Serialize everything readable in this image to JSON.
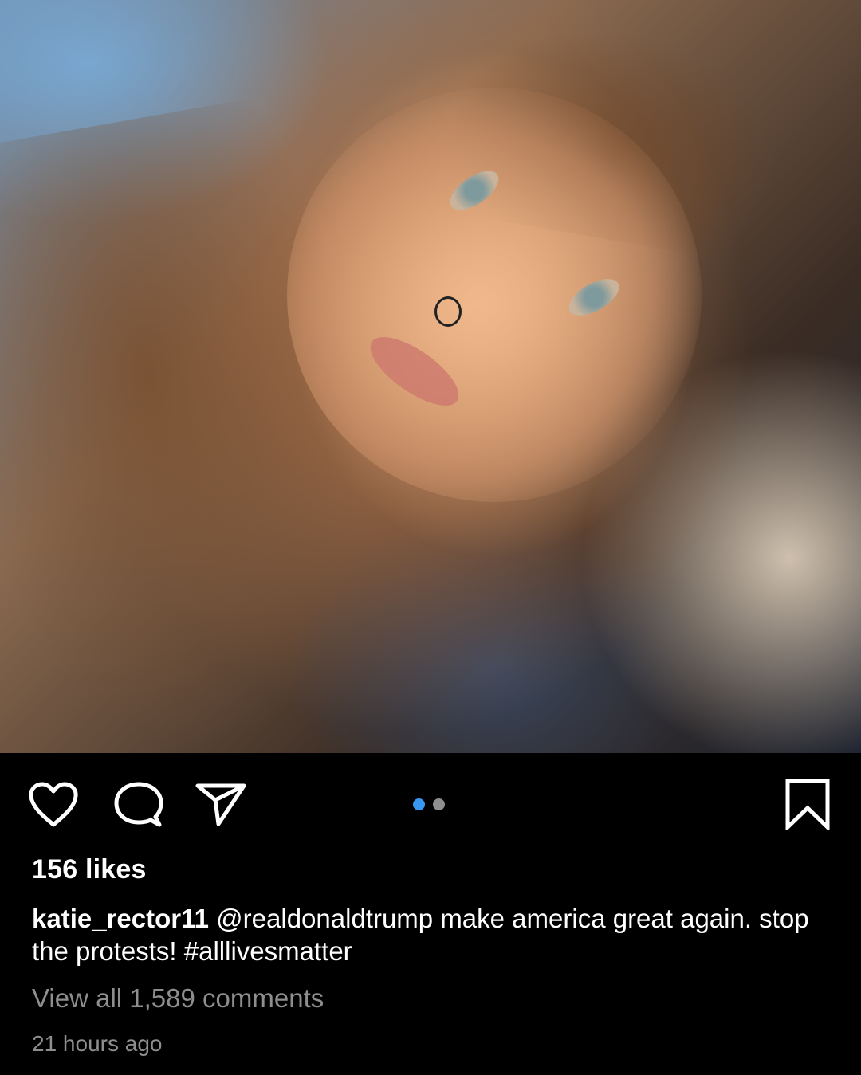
{
  "post": {
    "photo_alt": "",
    "carousel": {
      "current": 1,
      "total": 2
    },
    "likes_label": "156 likes",
    "caption": {
      "username": "katie_rector11",
      "text": " @realdonaldtrump make america great again. stop the protests! #alllivesmatter"
    },
    "view_comments_label": "View all 1,589 comments",
    "time_label": "21 hours ago"
  },
  "icons": {
    "like": "heart-outline-icon",
    "comment": "speech-bubble-icon",
    "share": "paper-plane-icon",
    "save": "bookmark-icon"
  },
  "colors": {
    "background": "#000000",
    "text": "#ffffff",
    "muted": "#8e8e8e",
    "active_dot": "#3897f0",
    "inactive_dot": "#8e8e8e"
  }
}
